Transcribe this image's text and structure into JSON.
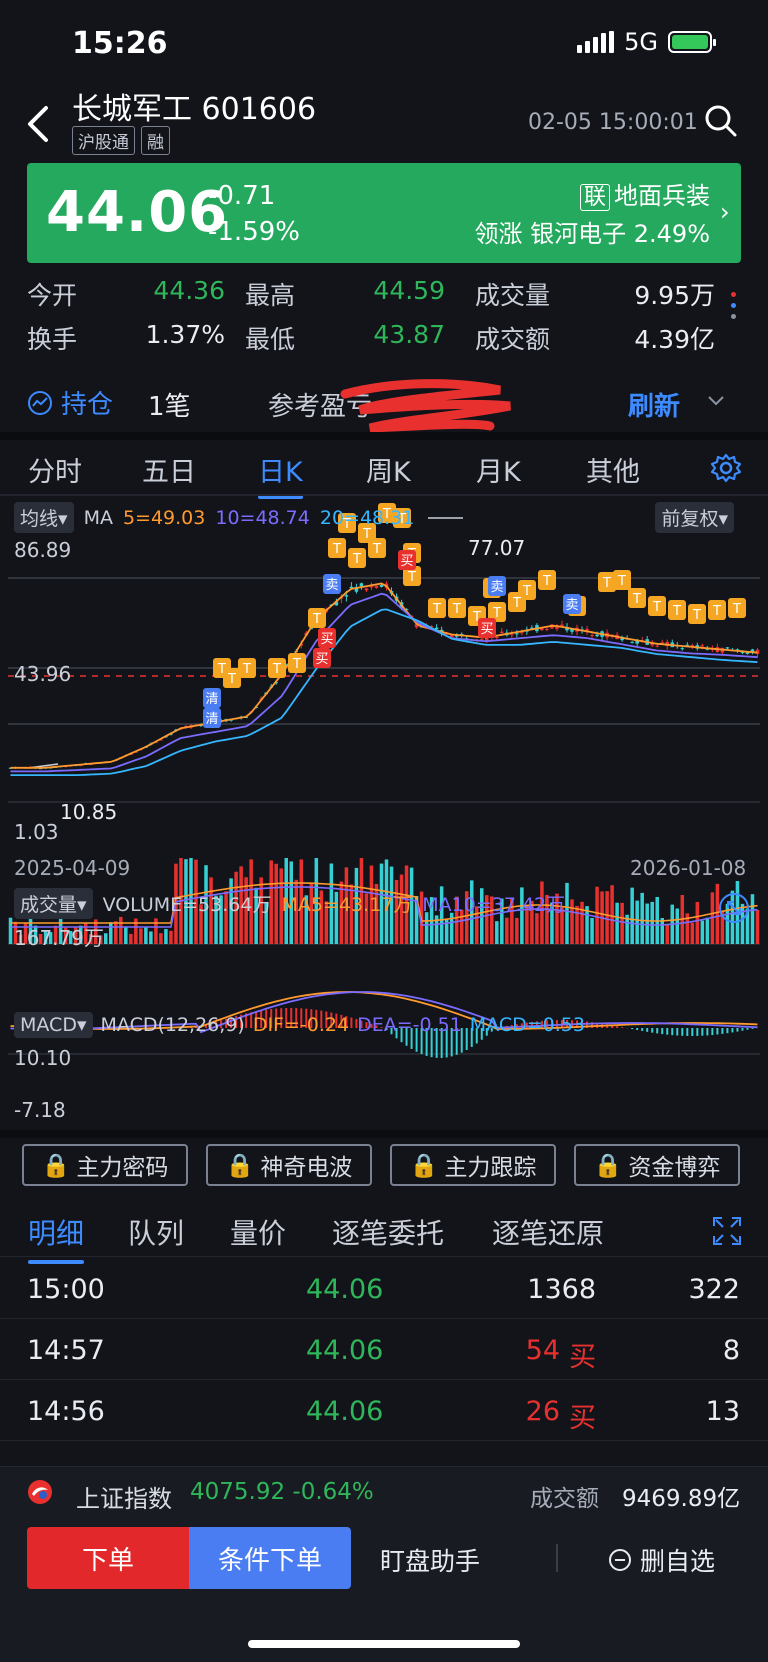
{
  "status_bar": {
    "time": "15:26",
    "network": "5G"
  },
  "header": {
    "stock_name": "长城军工 601606",
    "tags": [
      "沪股通",
      "融"
    ],
    "timestamp": "02-05 15:00:01"
  },
  "price_panel": {
    "price": "44.06",
    "change": "-0.71",
    "change_pct": "-1.59%",
    "sector_badge": "联",
    "sector_name": "地面兵装",
    "leader": "领涨 银河电子 2.49%"
  },
  "quote": {
    "open_label": "今开",
    "open": "44.36",
    "high_label": "最高",
    "high": "44.59",
    "volume_label": "成交量",
    "volume": "9.95万",
    "turnover_label": "换手",
    "turnover": "1.37%",
    "low_label": "最低",
    "low": "43.87",
    "amount_label": "成交额",
    "amount": "4.39亿"
  },
  "position": {
    "label": "持仓",
    "count": "1笔",
    "ref_label": "参考盈亏",
    "refresh": "刷新"
  },
  "kline_tabs": [
    "分时",
    "五日",
    "日K",
    "周K",
    "月K",
    "其他"
  ],
  "main_chart": {
    "ma_toggle": "均线",
    "ma_title": "MA",
    "ma5": "5=49.03",
    "ma10": "10=48.74",
    "ma20": "20=48.31",
    "adjust": "前复权",
    "y_top": "86.89",
    "y_mid": "43.96",
    "y_bottom": "1.03",
    "max_label": "77.07",
    "min_label": "10.85",
    "date_start": "2025-04-09",
    "date_end": "2026-01-08",
    "colors": {
      "ma5": "#ff9a2e",
      "ma10": "#7b6cff",
      "ma20": "#36b6ff",
      "up": "#e8312f",
      "down": "#36d0d4"
    }
  },
  "volume_chart": {
    "toggle": "成交量",
    "volume": "VOLUME=53.64万",
    "ma5": "MA5=43.17万",
    "ma10": "MA10=37.42万",
    "y_top": "167.79万"
  },
  "macd_chart": {
    "toggle": "MACD",
    "params": "MACD(12,26,9)",
    "dif": "DIF=-0.24",
    "dea": "DEA=-0.51",
    "macd": "MACD=0.53",
    "y_top": "10.10",
    "y_bottom": "-7.18"
  },
  "chart_data": {
    "type": "line",
    "title": "长城军工 601606 日K",
    "x": [
      "2025-04-09",
      "2026-01-08"
    ],
    "ylim": [
      1.03,
      86.89
    ],
    "series": [
      {
        "name": "MA5",
        "values": [
          11,
          11,
          12,
          13,
          18,
          24,
          26,
          28,
          42,
          60,
          70,
          72,
          58,
          55,
          54,
          56,
          58,
          56,
          54,
          52,
          51,
          50,
          49.03
        ]
      },
      {
        "name": "MA10",
        "values": [
          11,
          11,
          11.5,
          12,
          16,
          22,
          24,
          26,
          36,
          54,
          66,
          70,
          60,
          55,
          54,
          55,
          56,
          55,
          53,
          51,
          50,
          49.5,
          48.74
        ]
      },
      {
        "name": "MA20",
        "values": [
          11,
          11,
          11,
          11.5,
          14,
          19,
          22,
          24,
          30,
          46,
          60,
          66,
          62,
          56,
          54,
          54,
          55,
          54,
          53,
          51,
          50,
          49,
          48.31
        ]
      }
    ]
  },
  "func_buttons": [
    "主力密码",
    "神奇电波",
    "主力跟踪",
    "资金博弈"
  ],
  "detail_tabs": [
    "明细",
    "队列",
    "量价",
    "逐笔委托",
    "逐笔还原"
  ],
  "trades": [
    {
      "time": "15:00",
      "price": "44.06",
      "vol": "1368",
      "dir": "",
      "count": "322"
    },
    {
      "time": "14:57",
      "price": "44.06",
      "vol": "54",
      "dir": "买",
      "count": "8"
    },
    {
      "time": "14:56",
      "price": "44.06",
      "vol": "26",
      "dir": "买",
      "count": "13"
    }
  ],
  "index_bar": {
    "name": "上证指数",
    "value": "4075.92 -0.64%",
    "amount_label": "成交额",
    "amount": "9469.89亿"
  },
  "actions": {
    "order": "下单",
    "conditional": "条件下单",
    "watch": "盯盘助手",
    "remove": "删自选"
  }
}
